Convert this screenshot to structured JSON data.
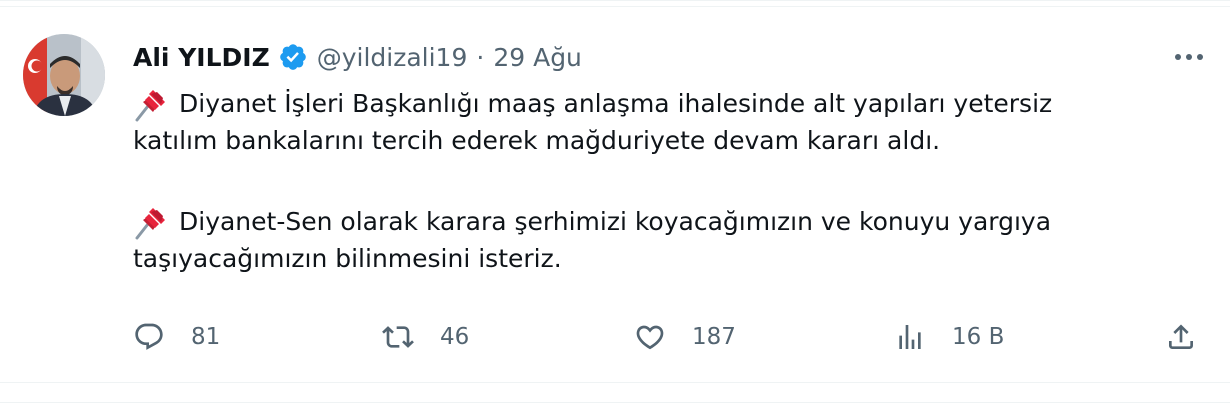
{
  "author": {
    "name": "Ali YILDIZ",
    "handle": "@yildizali19",
    "separator": "·",
    "date": "29 Ağu"
  },
  "tweet": {
    "paragraphs": [
      {
        "lines": [
          "Diyanet İşleri Başkanlığı maaş anlaşma ihalesinde alt yapıları yetersiz",
          "katılım bankalarını tercih ederek mağduriyete devam kararı aldı."
        ]
      },
      {
        "lines": [
          "Diyanet-Sen olarak karara şerhimizi koyacağımızın ve konuyu yargıya",
          "taşıyacağımızın bilinmesini isteriz."
        ]
      }
    ]
  },
  "actions": {
    "replies": "81",
    "retweets": "46",
    "likes": "187",
    "views": "16 B"
  },
  "icons": {
    "verified": "verified-badge-icon",
    "more": "more-horizontal-icon",
    "pin": "pushpin-emoji-icon",
    "reply": "reply-icon",
    "retweet": "retweet-icon",
    "like": "heart-icon",
    "views": "views-icon",
    "share": "share-icon"
  },
  "colors": {
    "text": "#0f1419",
    "secondary": "#536471",
    "verified": "#1d9bf0",
    "pin": "#e8243c",
    "divider": "#eff3f4"
  }
}
